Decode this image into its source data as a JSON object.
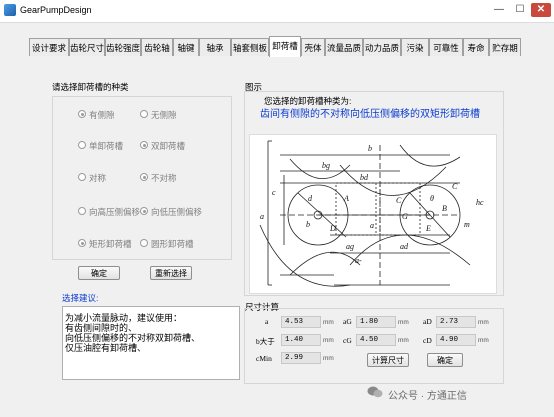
{
  "window": {
    "title": "GearPumpDesign",
    "minimize": "—",
    "maximize": "☐",
    "close": "✕"
  },
  "tabs": [
    "设计要求",
    "齿轮尺寸",
    "齿轮强度",
    "齿轮轴",
    "轴键",
    "轴承",
    "轴套侧板",
    "卸荷槽",
    "壳体",
    "流量品质",
    "动力品质",
    "污染",
    "可靠性",
    "寿命",
    "贮存期"
  ],
  "active_tab": "卸荷槽",
  "left": {
    "title": "请选择卸荷槽的种类",
    "options": [
      {
        "a": "有侧隙",
        "b": "无侧隙",
        "sel": "a",
        "enabled": false
      },
      {
        "a": "单卸荷槽",
        "b": "双卸荷槽",
        "sel": "b",
        "enabled": false
      },
      {
        "a": "对称",
        "b": "不对称",
        "sel": "b",
        "enabled": false
      },
      {
        "a": "向高压侧偏移",
        "b": "向低压侧偏移",
        "sel": "b",
        "enabled": false
      },
      {
        "a": "矩形卸荷槽",
        "b": "圆形卸荷槽",
        "sel": "a",
        "enabled": false
      }
    ],
    "confirm": "确定",
    "reselect": "重新选择",
    "suggest_title": "选择建议:",
    "suggestion_lines": [
      "为减小流量脉动，建议使用：",
      "有齿侧间隙时的、",
      "向低压侧偏移的不对称双卸荷槽、",
      "仅压油腔有卸荷槽、"
    ]
  },
  "right": {
    "diagram_title": "图示",
    "chosen_label": "您选择的卸荷槽种类为:",
    "chosen_value": "齿间有侧隙的不对称向低压侧偏移的双矩形卸荷槽",
    "drawing_labels": [
      "b",
      "bg",
      "bd",
      "C",
      "a",
      "ag",
      "ad",
      "a-",
      "a",
      "d",
      "b",
      "θ",
      "C",
      "G",
      "A",
      "B",
      "D",
      "E",
      "m",
      "hc",
      "c"
    ]
  },
  "calc": {
    "title": "尺寸计算",
    "fields": [
      {
        "label": "a",
        "value": "4.53",
        "unit": "mm"
      },
      {
        "label": "aG",
        "value": "1.80",
        "unit": "mm"
      },
      {
        "label": "aD",
        "value": "2.73",
        "unit": "mm"
      },
      {
        "label": "b大于",
        "value": "1.40",
        "unit": "mm"
      },
      {
        "label": "cG",
        "value": "4.50",
        "unit": "mm"
      },
      {
        "label": "cD",
        "value": "4.90",
        "unit": "mm"
      },
      {
        "label": "cMin",
        "value": "2.99",
        "unit": "mm"
      }
    ],
    "calc_btn": "计算尺寸",
    "ok_btn": "确定"
  },
  "watermark": "公众号 · 方通正信",
  "colors": {
    "accent": "#0b3bd0",
    "close": "#c94a3c"
  }
}
